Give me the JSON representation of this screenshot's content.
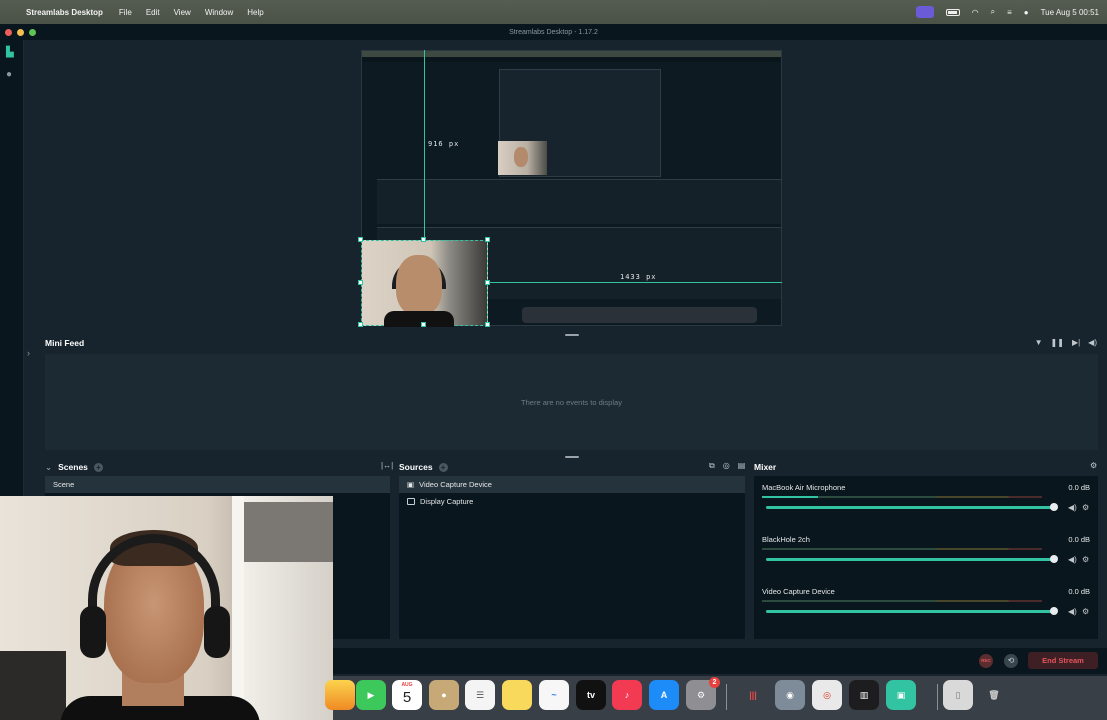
{
  "menubar": {
    "app_name": "Streamlabs Desktop",
    "menus": [
      "File",
      "Edit",
      "View",
      "Window",
      "Help"
    ],
    "datetime": "Tue Aug 5  00:51"
  },
  "window": {
    "title": "Streamlabs Desktop - 1.17.2"
  },
  "preview": {
    "height_label": "916 px",
    "width_label": "1433 px"
  },
  "mini_feed": {
    "title": "Mini Feed",
    "empty_text": "There are no events to display"
  },
  "scenes": {
    "title": "Scenes",
    "items": [
      {
        "label": "Scene",
        "selected": true
      }
    ]
  },
  "sources": {
    "title": "Sources",
    "items": [
      {
        "label": "Video Capture Device",
        "selected": true,
        "icon": "camera-icon"
      },
      {
        "label": "Display Capture",
        "selected": false,
        "icon": "monitor-icon"
      }
    ]
  },
  "mixer": {
    "title": "Mixer",
    "items": [
      {
        "name": "MacBook Air Microphone",
        "db": "0.0 dB",
        "level": 0.2,
        "volume": 1.0
      },
      {
        "name": "BlackHole 2ch",
        "db": "0.0 dB",
        "level": 0.0,
        "volume": 1.0
      },
      {
        "name": "Video Capture Device",
        "db": "0.0 dB",
        "level": 0.0,
        "volume": 1.0
      }
    ]
  },
  "footer": {
    "rec_label": "REC",
    "end_stream_label": "End Stream"
  },
  "dock": {
    "calendar_month": "AUG",
    "calendar_day": "5",
    "appletv_label": "tv",
    "settings_badge": "2"
  },
  "colors": {
    "accent": "#31c3a2",
    "background": "#17242d",
    "panel": "#09161d",
    "danger": "#e4555d"
  }
}
